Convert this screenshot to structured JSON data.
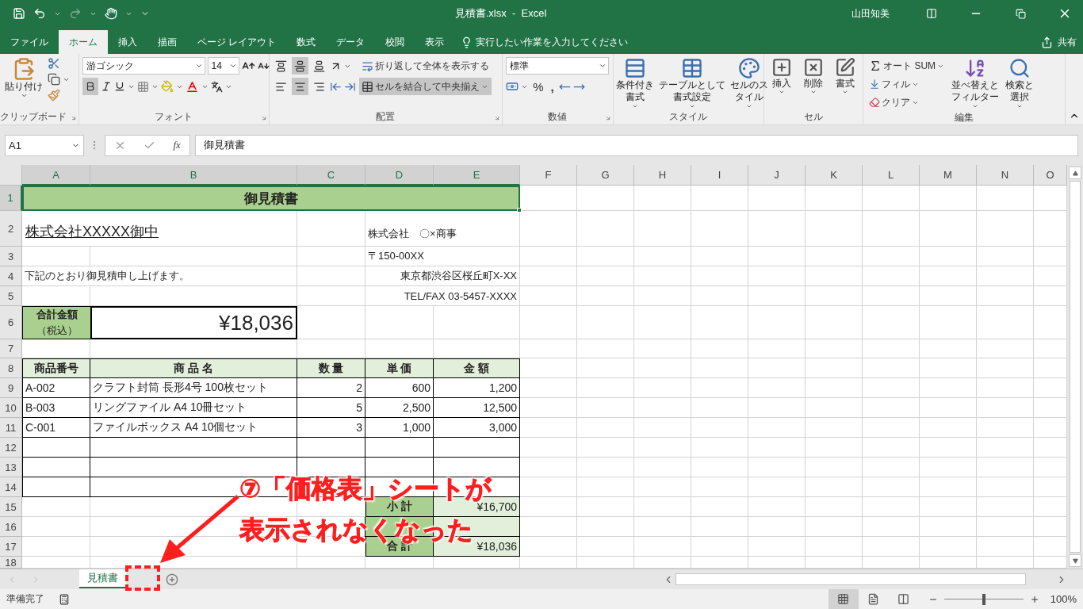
{
  "window": {
    "title": "見積書.xlsx  -  Excel",
    "user": "山田知美"
  },
  "tabs": [
    {
      "label": "ファイル",
      "selected": false
    },
    {
      "label": "ホーム",
      "selected": true
    },
    {
      "label": "挿入",
      "selected": false
    },
    {
      "label": "描画",
      "selected": false
    },
    {
      "label": "ページ レイアウト",
      "selected": false
    },
    {
      "label": "数式",
      "selected": false
    },
    {
      "label": "データ",
      "selected": false
    },
    {
      "label": "校閲",
      "selected": false
    },
    {
      "label": "表示",
      "selected": false
    }
  ],
  "tell_me": {
    "placeholder": "実行したい作業を入力してください"
  },
  "share": "共有",
  "ribbon": {
    "clipboard": {
      "label": "クリップボード",
      "paste": "貼り付け"
    },
    "font": {
      "label": "フォント",
      "font_name": "游ゴシック",
      "font_size": "14"
    },
    "alignment": {
      "label": "配置",
      "vertical": [
        {
          "selected": false
        },
        {
          "selected": true
        },
        {
          "selected": false
        }
      ],
      "horizontal": [
        {
          "selected": false
        },
        {
          "selected": true
        },
        {
          "selected": false
        }
      ],
      "wrap": "折り返して全体を表示する",
      "merge": {
        "label": "セルを結合して中央揃え",
        "selected": true
      }
    },
    "number": {
      "label": "数値",
      "format": "標準",
      "percent": "%",
      "comma": ","
    },
    "styles": {
      "label": "スタイル",
      "buttons": [
        "条件付き書式",
        "テーブルとして書式設定",
        "セルのスタイル"
      ]
    },
    "cells": {
      "label": "セル",
      "buttons": [
        "挿入",
        "削除",
        "書式"
      ]
    },
    "editing": {
      "label": "編集",
      "autosum": "オート SUM",
      "fill": "フィル",
      "clear": "クリア",
      "sort": "並べ替えとフィルター",
      "find": "検索と選択"
    }
  },
  "formula_bar": {
    "name_box": "A1",
    "fx": "fx",
    "value": "御見積書"
  },
  "columns": [
    {
      "label": "A",
      "selected": true
    },
    {
      "label": "B",
      "selected": true
    },
    {
      "label": "C",
      "selected": true
    },
    {
      "label": "D",
      "selected": true
    },
    {
      "label": "E",
      "selected": true
    },
    {
      "label": "F",
      "selected": false
    },
    {
      "label": "G",
      "selected": false
    },
    {
      "label": "H",
      "selected": false
    },
    {
      "label": "I",
      "selected": false
    },
    {
      "label": "J",
      "selected": false
    },
    {
      "label": "K",
      "selected": false
    },
    {
      "label": "L",
      "selected": false
    },
    {
      "label": "M",
      "selected": false
    },
    {
      "label": "N",
      "selected": false
    },
    {
      "label": "O",
      "selected": false
    }
  ],
  "rows": [
    {
      "number": "1",
      "selected": true,
      "kind": "title",
      "text": "御見積書"
    },
    {
      "number": "2",
      "selected": false,
      "kind": "recipient",
      "left": {
        "kind": "recipient",
        "text": "株式会社XXXXX御中"
      },
      "right": {
        "kind": "sender",
        "text": "株式会社　〇×商事"
      }
    },
    {
      "number": "3",
      "selected": false,
      "kind": "line",
      "right": {
        "kind": "sender",
        "text": "〒150-00XX"
      }
    },
    {
      "number": "4",
      "selected": false,
      "kind": "line",
      "left": {
        "kind": "note",
        "text": "下記のとおり御見積申し上げます。"
      },
      "right": {
        "kind": "address",
        "text": "東京都渋谷区桜丘町X-XX"
      }
    },
    {
      "number": "5",
      "selected": false,
      "kind": "line",
      "right": {
        "kind": "address",
        "text": "TEL/FAX 03-5457-XXXX"
      }
    },
    {
      "number": "6",
      "selected": false,
      "kind": "total",
      "heading": "合計金額",
      "subheading": "（税込）",
      "amount": "¥18,036"
    },
    {
      "number": "7",
      "selected": false,
      "kind": "blank"
    },
    {
      "number": "8",
      "selected": false,
      "kind": "table-head",
      "cells": [
        "商品番号",
        "商 品 名",
        "数 量",
        "単 価",
        "金 額"
      ]
    },
    {
      "number": "9",
      "selected": false,
      "kind": "item",
      "cells": [
        "A-002",
        "クラフト封筒 長形4号 100枚セット",
        "2",
        "600",
        "1,200"
      ]
    },
    {
      "number": "10",
      "selected": false,
      "kind": "item",
      "cells": [
        "B-003",
        "リングファイル A4 10冊セット",
        "5",
        "2,500",
        "12,500"
      ]
    },
    {
      "number": "11",
      "selected": false,
      "kind": "item",
      "cells": [
        "C-001",
        "ファイルボックス A4 10個セット",
        "3",
        "1,000",
        "3,000"
      ]
    },
    {
      "number": "12",
      "selected": false,
      "kind": "item"
    },
    {
      "number": "13",
      "selected": false,
      "kind": "item"
    },
    {
      "number": "14",
      "selected": false,
      "kind": "item"
    },
    {
      "number": "15",
      "selected": false,
      "kind": "summary",
      "label": "小 計",
      "value": "¥16,700"
    },
    {
      "number": "16",
      "selected": false,
      "kind": "summary"
    },
    {
      "number": "17",
      "selected": false,
      "kind": "summary",
      "label": "合 計",
      "value": "¥18,036"
    },
    {
      "number": "18",
      "selected": false,
      "kind": "cut"
    }
  ],
  "sheet_tabs": [
    {
      "label": "見積書",
      "selected": true
    }
  ],
  "annotation": {
    "lines": [
      "⑦「価格表」シートが",
      "表示されなくなった"
    ]
  },
  "status_bar": {
    "text": "準備完了",
    "views": [
      {
        "kind": "normal",
        "selected": true
      },
      {
        "kind": "layout",
        "selected": false
      },
      {
        "kind": "break",
        "selected": false
      }
    ],
    "zoom": {
      "level": 0.5,
      "reading": "100%"
    }
  }
}
